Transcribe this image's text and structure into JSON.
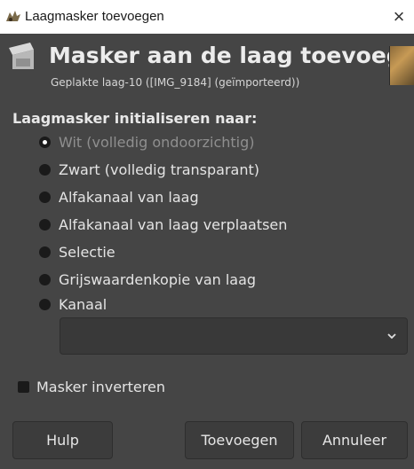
{
  "window": {
    "title": "Laagmasker toevoegen",
    "app_icon": "gimp-wilber-icon",
    "close_label": "×"
  },
  "header": {
    "icon": "layer-mask-icon",
    "title": "Masker aan de laag toevoegen",
    "subtitle": "Geplakte laag-10 ([IMG_9184] (geïmporteerd))"
  },
  "init": {
    "label": "Laagmasker initialiseren naar:",
    "options": [
      {
        "label": "Wit (volledig ondoorzichtig)",
        "selected": true
      },
      {
        "label": "Zwart (volledig transparant)",
        "selected": false
      },
      {
        "label": "Alfakanaal van laag",
        "selected": false
      },
      {
        "label": "Alfakanaal van laag verplaatsen",
        "selected": false
      },
      {
        "label": "Selectie",
        "selected": false
      },
      {
        "label": "Grijswaardenkopie van laag",
        "selected": false
      },
      {
        "label": "Kanaal",
        "selected": false
      }
    ]
  },
  "channel_select": {
    "value": "",
    "icon": "chevron-down-icon"
  },
  "invert": {
    "label": "Masker inverteren",
    "checked": false
  },
  "buttons": {
    "help": "Hulp",
    "add": "Toevoegen",
    "cancel": "Annuleer"
  },
  "colors": {
    "dialog_bg": "#454545",
    "titlebar_bg": "#ffffff",
    "text": "#e4e4e4"
  }
}
